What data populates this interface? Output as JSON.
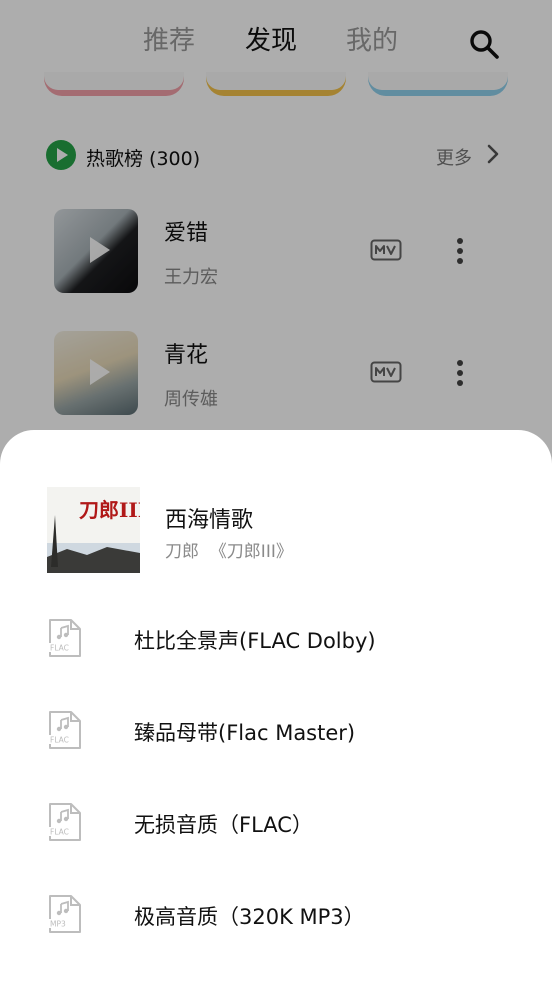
{
  "tabs": [
    {
      "label": "推荐",
      "active": false
    },
    {
      "label": "发现",
      "active": true
    },
    {
      "label": "我的",
      "active": false
    }
  ],
  "chart": {
    "title": "热歌榜 (300)",
    "more_label": "更多"
  },
  "songs": [
    {
      "title": "爱错",
      "artist": "王力宏"
    },
    {
      "title": "青花",
      "artist": "周传雄"
    }
  ],
  "sheet": {
    "song_title": "西海情歌",
    "song_artist": "刀郎",
    "song_album": "《刀郎III》",
    "subtitle": "刀郎  《刀郎III》",
    "album_art_text": "刀郎III",
    "qualities": [
      {
        "label": "杜比全景声(FLAC Dolby)",
        "badge": "FLAC"
      },
      {
        "label": "臻品母带(Flac Master)",
        "badge": "FLAC"
      },
      {
        "label": "无损音质（FLAC）",
        "badge": "FLAC"
      },
      {
        "label": "极高音质（320K MP3）",
        "badge": "MP3"
      }
    ]
  },
  "icons": {
    "search": "search-icon",
    "mv": "mv-icon",
    "more": "more-vertical-icon",
    "file": "music-file-icon"
  },
  "colors": {
    "accent_green": "#25a248",
    "overlay": "rgba(0,0,0,0.32)"
  }
}
